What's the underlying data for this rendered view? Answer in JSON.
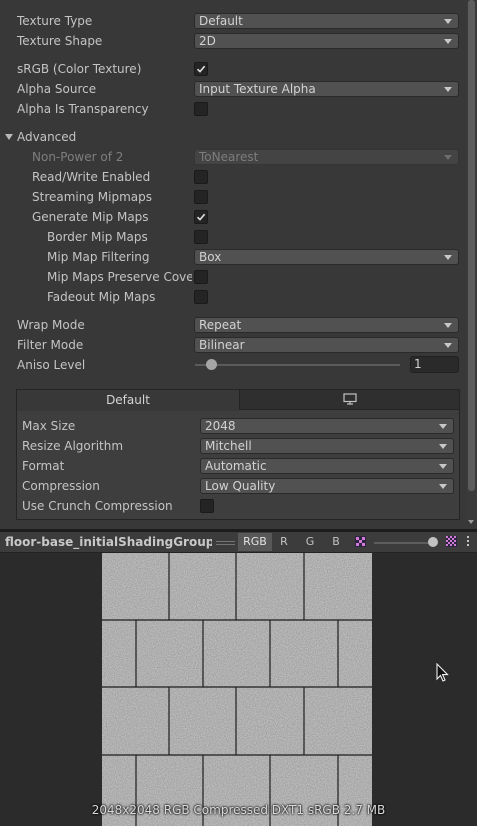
{
  "inspector": {
    "texture_type": {
      "label": "Texture Type",
      "value": "Default"
    },
    "texture_shape": {
      "label": "Texture Shape",
      "value": "2D"
    },
    "srgb": {
      "label": "sRGB (Color Texture)",
      "checked": true
    },
    "alpha_source": {
      "label": "Alpha Source",
      "value": "Input Texture Alpha"
    },
    "alpha_is_transparency": {
      "label": "Alpha Is Transparency",
      "checked": false
    },
    "advanced": {
      "label": "Advanced",
      "non_power_of_2": {
        "label": "Non-Power of 2",
        "value": "ToNearest"
      },
      "read_write": {
        "label": "Read/Write Enabled",
        "checked": false
      },
      "streaming_mipmaps": {
        "label": "Streaming Mipmaps",
        "checked": false
      },
      "generate_mip_maps": {
        "label": "Generate Mip Maps",
        "checked": true
      },
      "border_mip_maps": {
        "label": "Border Mip Maps",
        "checked": false
      },
      "mip_map_filtering": {
        "label": "Mip Map Filtering",
        "value": "Box"
      },
      "mip_maps_preserve_coverage": {
        "label": "Mip Maps Preserve Cover",
        "checked": false
      },
      "fadeout_mip_maps": {
        "label": "Fadeout Mip Maps",
        "checked": false
      }
    },
    "wrap_mode": {
      "label": "Wrap Mode",
      "value": "Repeat"
    },
    "filter_mode": {
      "label": "Filter Mode",
      "value": "Bilinear"
    },
    "aniso_level": {
      "label": "Aniso Level",
      "value": "1"
    },
    "platform": {
      "tab_default": "Default",
      "tab_standalone_icon": "monitor-icon",
      "max_size": {
        "label": "Max Size",
        "value": "2048"
      },
      "resize_algorithm": {
        "label": "Resize Algorithm",
        "value": "Mitchell"
      },
      "format": {
        "label": "Format",
        "value": "Automatic"
      },
      "compression": {
        "label": "Compression",
        "value": "Low Quality"
      },
      "use_crunch": {
        "label": "Use Crunch Compression",
        "checked": false
      }
    }
  },
  "preview": {
    "asset_name": "floor-base_initialShadingGroup_Alb",
    "channels": [
      "RGB",
      "R",
      "G",
      "B"
    ],
    "active_channel": "RGB",
    "info": "2048x2048  RGB Compressed DXT1 sRGB   2.7 MB"
  },
  "colors": {
    "panel_bg": "#383838",
    "field_bg": "#515151",
    "checkbox_bg": "#242424",
    "preview_bg": "#2b2b2b"
  }
}
